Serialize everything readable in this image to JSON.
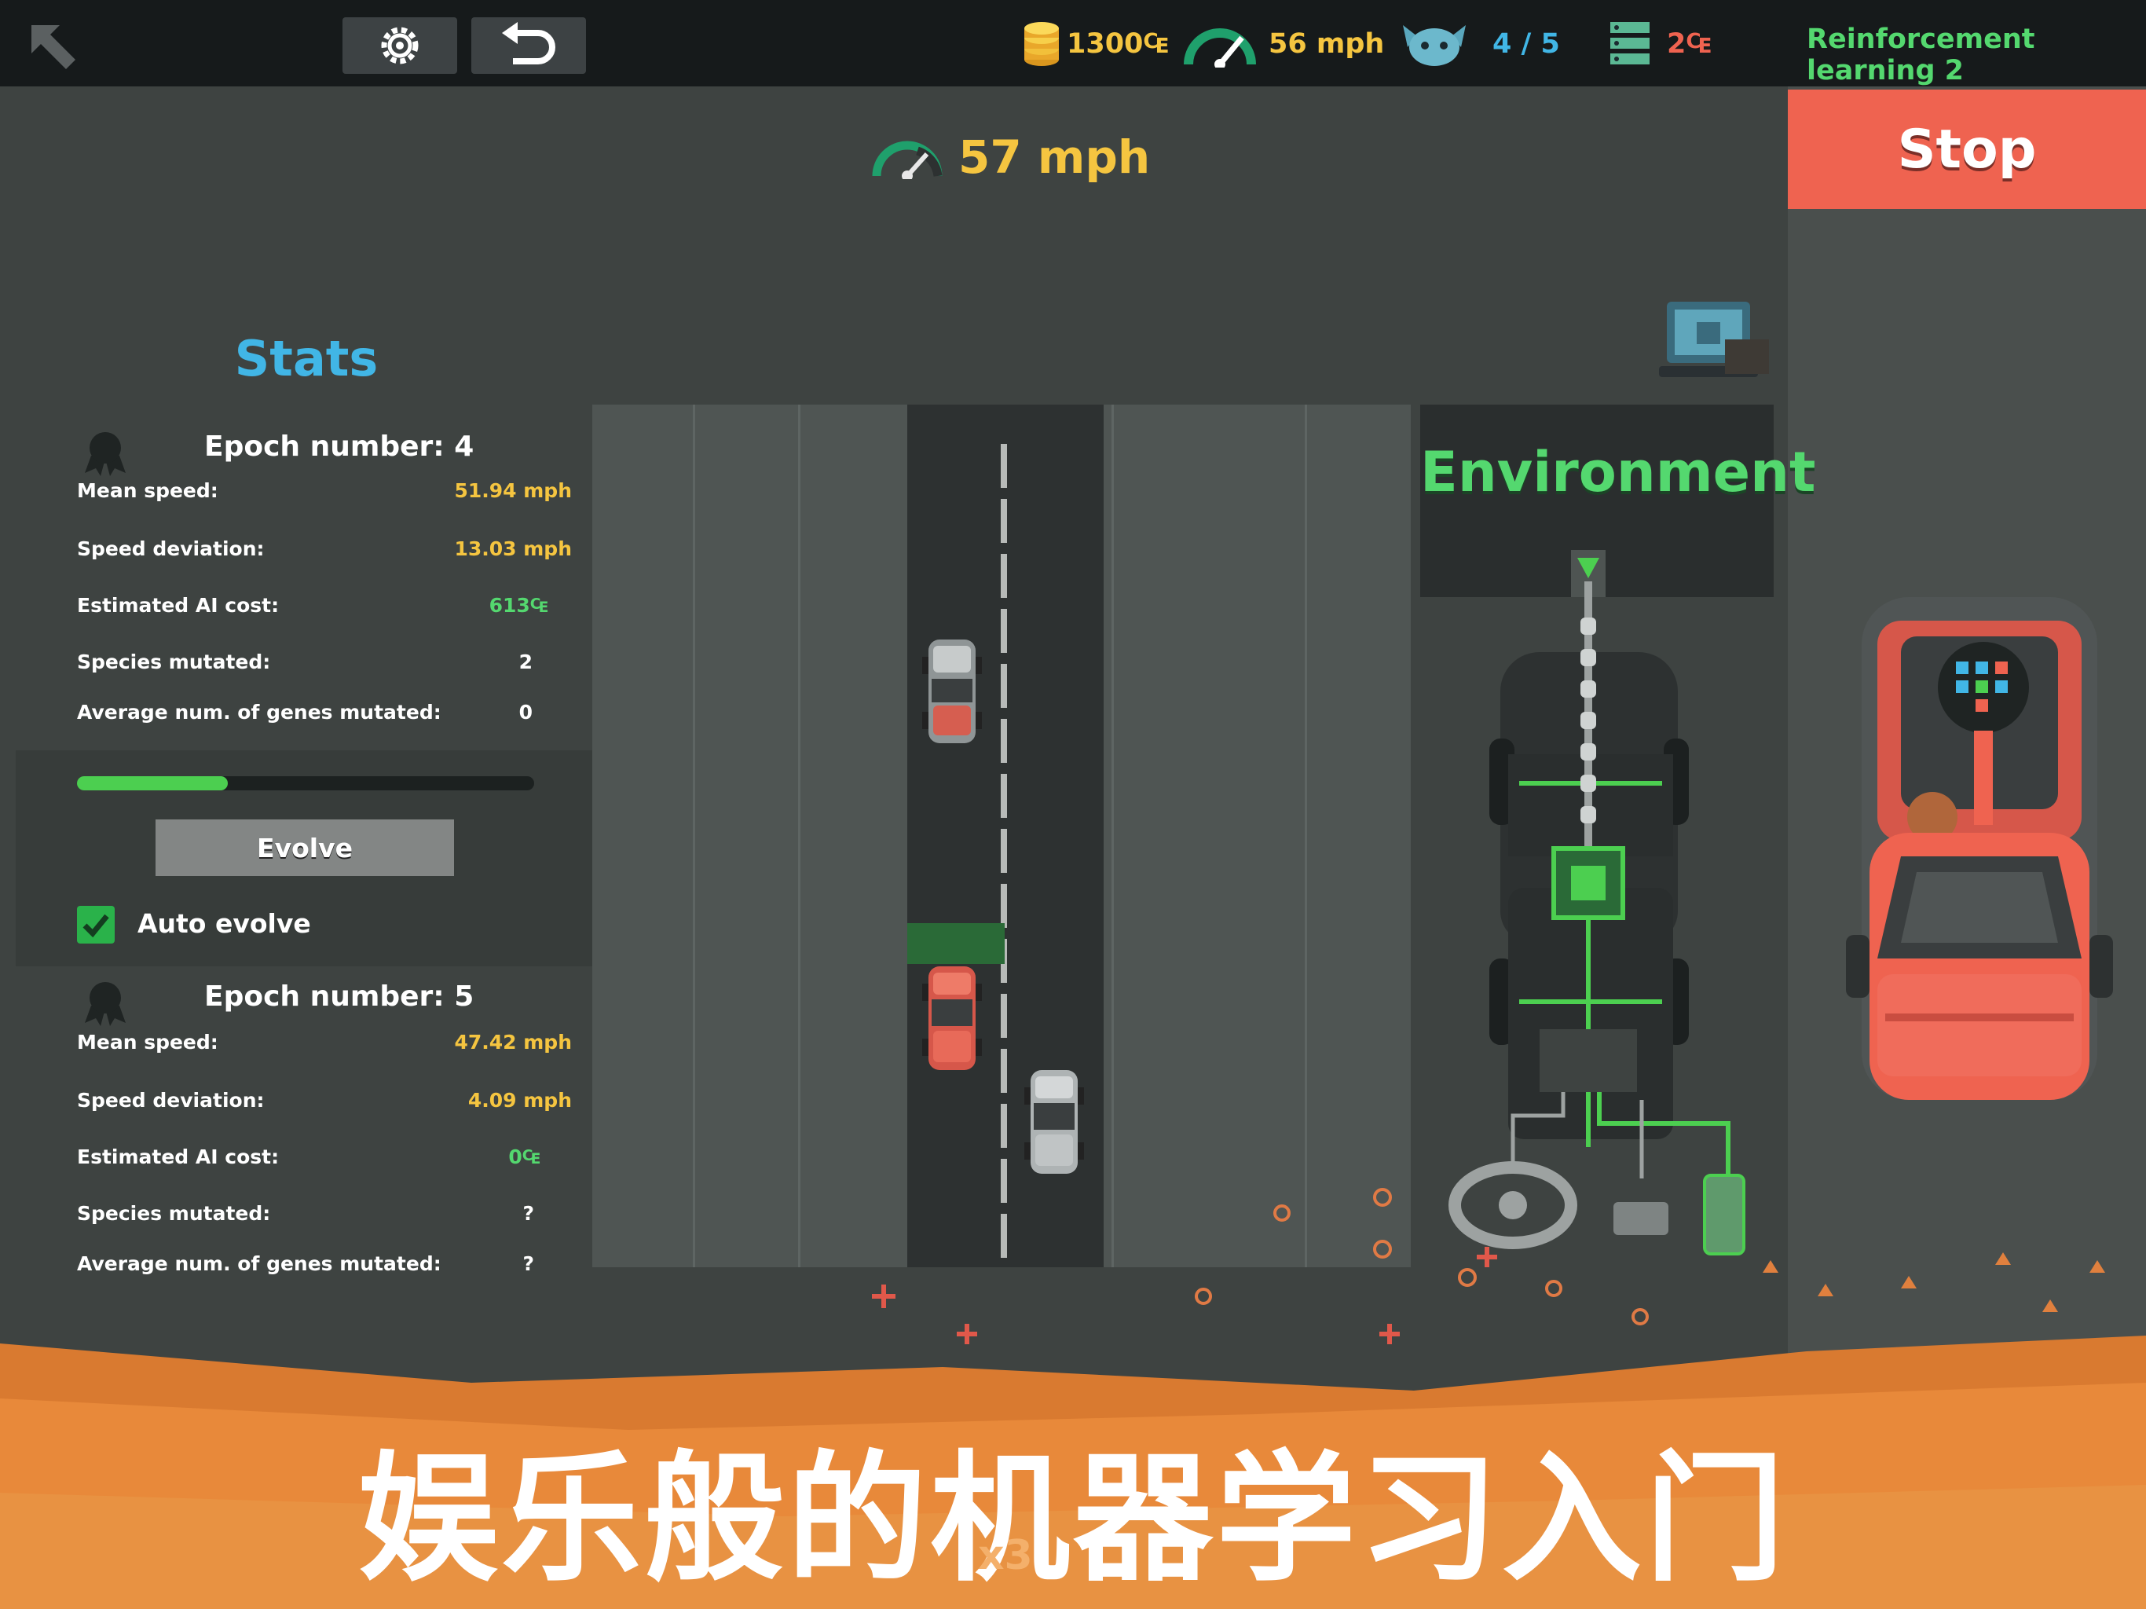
{
  "topbar": {
    "coins": "1300₠",
    "speed": "56 mph",
    "agents": "4 / 5",
    "servers": "2₠",
    "level_title": "Reinforcement learning 2"
  },
  "speed_display": "57 mph",
  "stop_label": "Stop",
  "stats": {
    "title": "Stats",
    "epochs": [
      {
        "title": "Epoch number: 4",
        "rows": [
          {
            "label": "Mean speed:",
            "value": "51.94 mph",
            "color": "#f5c540"
          },
          {
            "label": "Speed deviation:",
            "value": "13.03 mph",
            "color": "#f5c540"
          },
          {
            "label": "Estimated AI cost:",
            "value": "613₠",
            "color": "#54d86f"
          },
          {
            "label": "Species mutated:",
            "value": "2",
            "color": "#ffffff"
          },
          {
            "label": "Average num. of genes mutated:",
            "value": "0",
            "color": "#ffffff"
          }
        ]
      },
      {
        "title": "Epoch number: 5",
        "rows": [
          {
            "label": "Mean speed:",
            "value": "47.42 mph",
            "color": "#f5c540"
          },
          {
            "label": "Speed deviation:",
            "value": "4.09 mph",
            "color": "#f5c540"
          },
          {
            "label": "Estimated AI cost:",
            "value": "0₠",
            "color": "#54d86f"
          },
          {
            "label": "Species mutated:",
            "value": "?",
            "color": "#ffffff"
          },
          {
            "label": "Average num. of genes mutated:",
            "value": "?",
            "color": "#ffffff"
          }
        ]
      }
    ],
    "training_progress": 0.33,
    "evolve_label": "Evolve",
    "auto_evolve_label": "Auto evolve",
    "auto_evolve_checked": true
  },
  "environment_label": "Environment",
  "banner_text": "娱乐般的机器学习入门",
  "multiplier_text": "x3",
  "colors": {
    "accent_blue": "#41b6e6",
    "accent_green": "#54d86f",
    "accent_yellow": "#f5c540",
    "stop_red": "#ef6350",
    "banner_orange": "#e8893a"
  }
}
